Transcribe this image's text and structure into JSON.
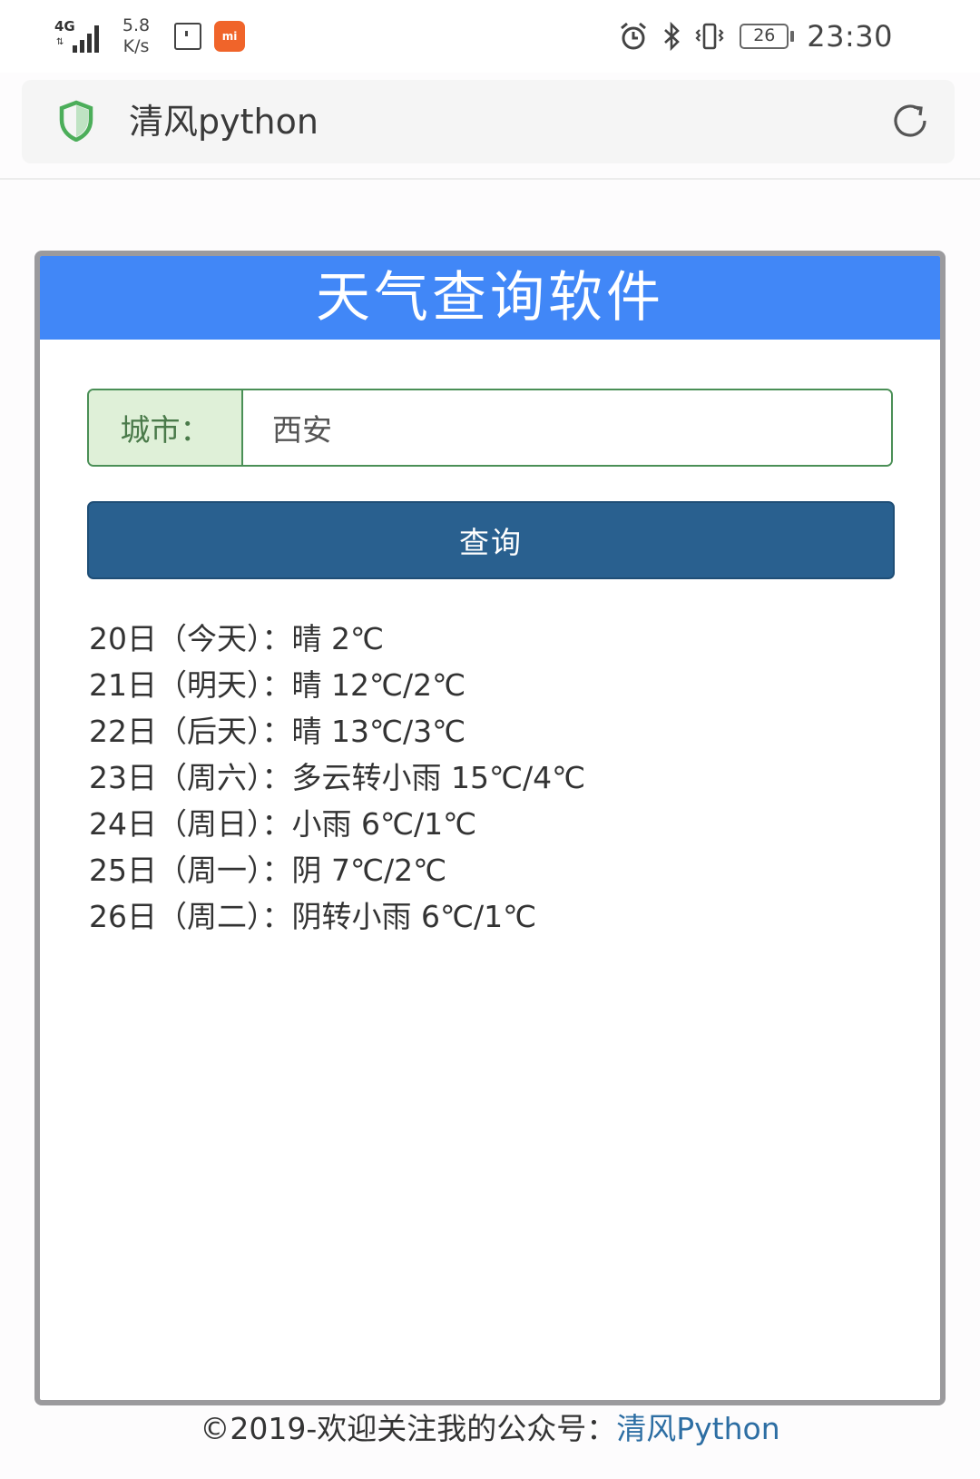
{
  "status_bar": {
    "network": "4G",
    "speed_value": "5.8",
    "speed_unit": "K/s",
    "battery": "26",
    "time": "23:30"
  },
  "browser": {
    "title": "清风python"
  },
  "app": {
    "title": "天气查询软件",
    "city_label": "城市：",
    "city_value": "西安",
    "query_button": "查询",
    "forecast": [
      "20日（今天）：晴 2℃",
      "21日（明天）：晴 12℃/2℃",
      "22日（后天）：晴 13℃/3℃",
      "23日（周六）：多云转小雨 15℃/4℃",
      "24日（周日）：小雨 6℃/1℃",
      "25日（周一）：阴 7℃/2℃",
      "26日（周二）：阴转小雨 6℃/1℃"
    ]
  },
  "footer": {
    "text": "©2019-欢迎关注我的公众号：",
    "link": "清风Python"
  },
  "colors": {
    "header_blue": "#4187f7",
    "button_blue": "#29608f",
    "input_green_border": "#4a8f56",
    "label_green_bg": "#dff0d8",
    "shield_green": "#4cae5a",
    "mi_orange": "#f0642a"
  }
}
